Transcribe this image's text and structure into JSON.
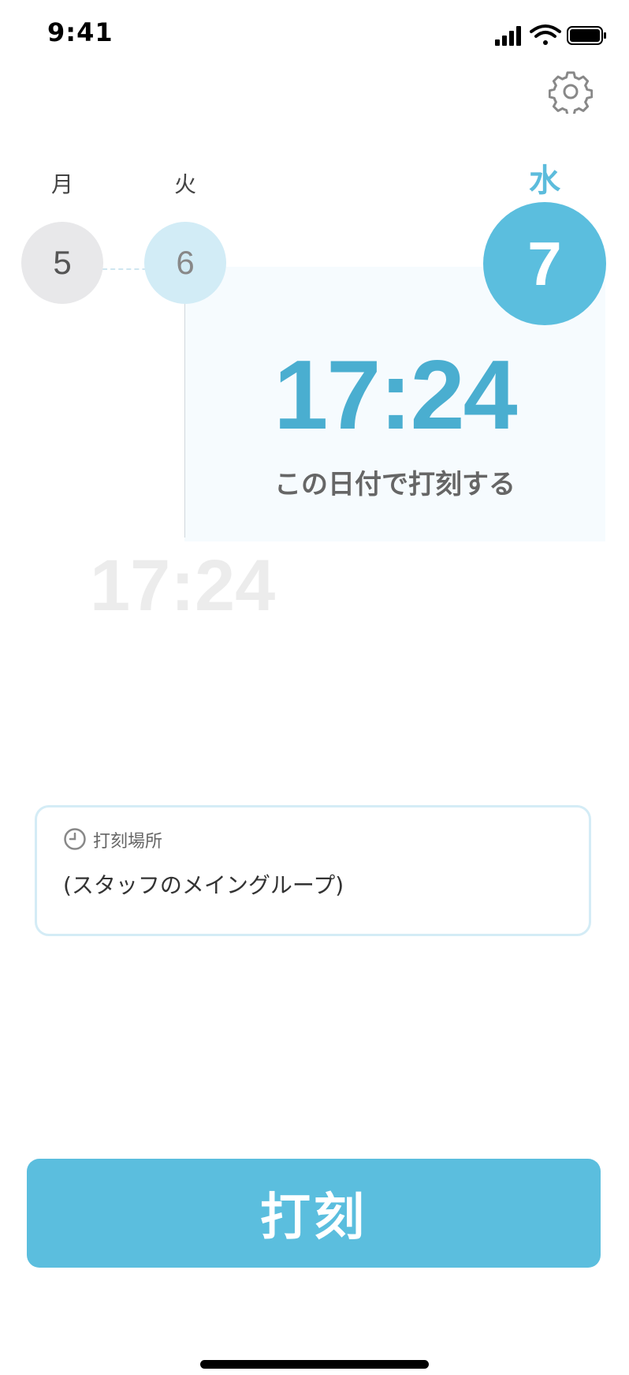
{
  "status_bar": {
    "time": "9:41"
  },
  "days": [
    {
      "weekday": "月",
      "date": "5"
    },
    {
      "weekday": "火",
      "date": "6"
    },
    {
      "weekday": "水",
      "date": "7"
    }
  ],
  "selected": {
    "time": "17:24",
    "action_label": "この日付で打刻する"
  },
  "previous_time": "17:24",
  "location": {
    "label": "打刻場所",
    "value": "(スタッフのメイングループ)"
  },
  "punch_button": {
    "label": "打刻"
  },
  "colors": {
    "accent": "#5bbede",
    "accent_dark": "#4aaed0",
    "panel_bg": "#f6fbfe"
  },
  "icons": {
    "settings": "gear-icon",
    "location": "clock-icon"
  }
}
